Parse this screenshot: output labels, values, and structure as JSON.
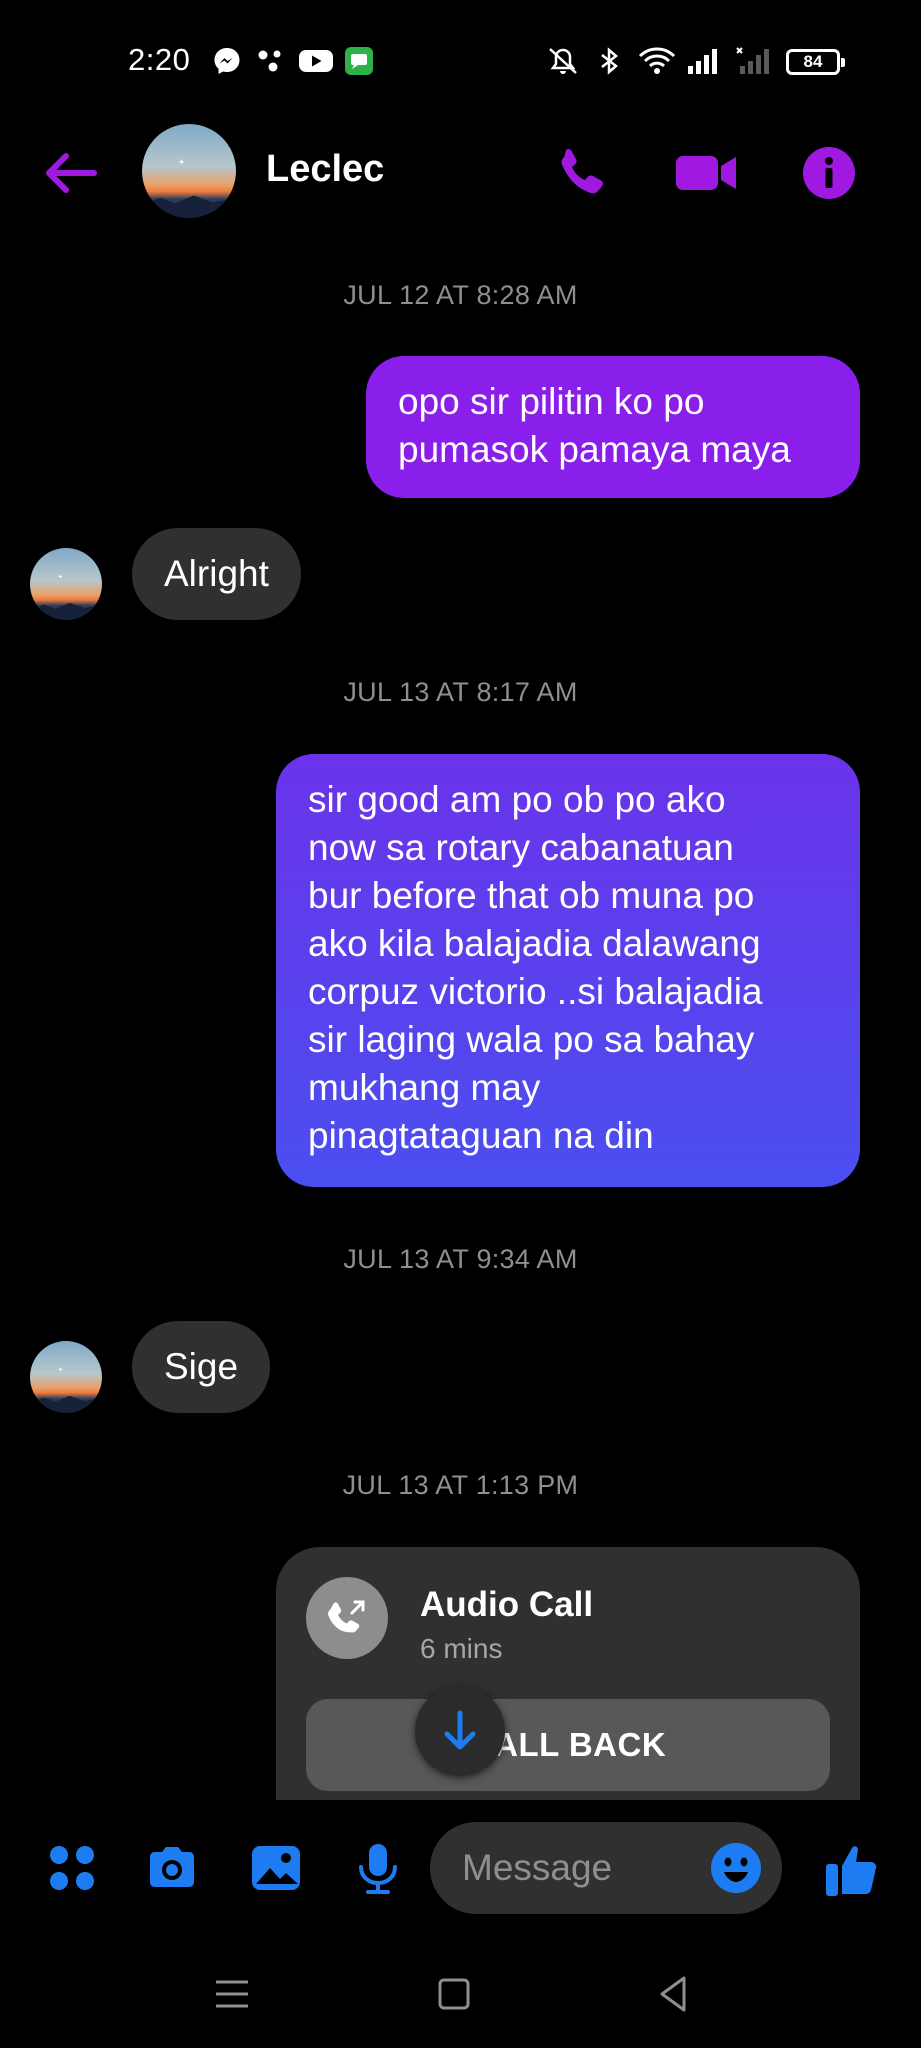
{
  "status_bar": {
    "time": "2:20",
    "battery": "84",
    "icons": [
      "messenger-icon",
      "app-dots-icon",
      "youtube-icon",
      "messages-app-icon",
      "mute-icon",
      "bluetooth-icon",
      "wifi-icon",
      "signal-icon",
      "signal-no-service-icon",
      "battery-icon"
    ]
  },
  "header": {
    "contact_name": "Leclec",
    "accent_color": "#a019e0"
  },
  "conversation": {
    "timestamps": [
      "JUL 12 AT 8:28 AM",
      "JUL 13 AT 8:17 AM",
      "JUL 13 AT 9:34 AM",
      "JUL 13 AT 1:13 PM"
    ],
    "messages": [
      {
        "sender": "me",
        "lines": [
          "opo sir pilitin ko po",
          "pumasok pamaya maya"
        ]
      },
      {
        "sender": "contact",
        "text": "Alright"
      },
      {
        "sender": "me",
        "lines": [
          "sir good am po ob po ako",
          "now sa rotary cabanatuan",
          "bur before that ob muna po",
          "ako kila balajadia dalawang",
          "corpuz victorio ..si balajadia",
          "sir laging wala po sa bahay",
          "mukhang may",
          "pinagtataguan na din"
        ]
      },
      {
        "sender": "contact",
        "text": "Sige"
      }
    ],
    "call_card": {
      "title": "Audio Call",
      "duration": "6 mins",
      "button_label": "CALL BACK"
    }
  },
  "composer": {
    "placeholder": "Message",
    "accent_color": "#1e7cf2"
  }
}
